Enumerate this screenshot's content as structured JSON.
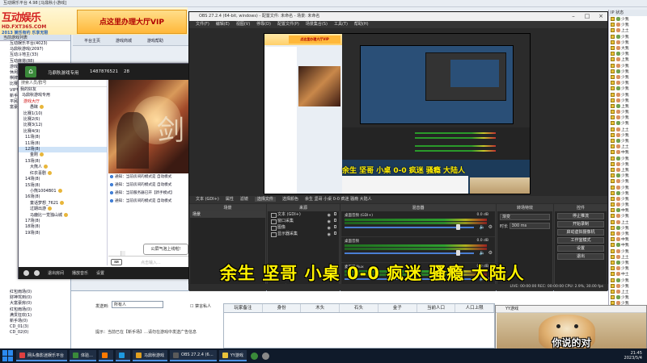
{
  "bg": {
    "window_title": "互动娱乐平台 4.98 [马鼎秋小游戏]",
    "logo_line1": "互动娱乐",
    "logo_line2": "HD.FXT365.COM",
    "logo_line3": "2013 娱乐有约 乐享无限",
    "vip_banner": "点这里办理大厅VIP",
    "toolbar": [
      "平台主页",
      "游戏商城",
      "游戏帮助"
    ],
    "left_header": "当前游戏列表",
    "left_tree": [
      "互动娱乐平台(4023)",
      "马鼎秋游戏(2097)",
      "互动斗地主(33)",
      "互动麻将(88)",
      "游戏大厅",
      "休闲游戏",
      "棋牌游戏",
      "比赛场",
      "VIP专区",
      "新手场",
      "平民场",
      "富豪场"
    ],
    "bottom_tree": [
      "红包雨场(0)",
      "财神驾到(0)",
      "大富豪房(0)",
      "红包雨场(0)",
      "满贯狂欢(1)",
      "新手场(0)",
      "CD_01(3)",
      "CD_02(0)"
    ],
    "send_label": "发送到:",
    "send_to": "所有人",
    "check_label": "禁言私人",
    "tip": "提示：当前已在【新手场】…请勿在游戏中发送广告信息",
    "table_headers": [
      "玩家备注",
      "身份",
      "木头",
      "石头",
      "金子",
      "当前人口",
      "人口上限"
    ],
    "right_header": "IP 状态",
    "right_names": [
      "少我",
      "少我",
      "上土",
      "少我",
      "少我",
      "大我",
      "少我",
      "上我",
      "少我",
      "少我",
      "少我",
      "少我",
      "少我",
      "少我",
      "少我",
      "上我",
      "少我",
      "少我",
      "少我",
      "上土",
      "少我",
      "少我",
      "上土",
      "中我",
      "少我",
      "少我",
      "上我",
      "少我",
      "少我",
      "少我",
      "少我",
      "少我",
      "少我",
      "中我",
      "少我",
      "上土",
      "少我",
      "少我",
      "中我",
      "中我",
      "少我",
      "上土",
      "少我",
      "少我",
      "中土",
      "少我",
      "少我",
      "上土",
      "少我",
      "少我",
      "少我",
      "少我",
      "中土",
      "少我",
      "少我",
      "少我"
    ]
  },
  "chat": {
    "title": "马鼎秋游戏专用",
    "id": "1487876521",
    "count": "28",
    "search": "搜索人员/群号",
    "tree": [
      {
        "t": "我的好友",
        "ind": 2,
        "cls": ""
      },
      {
        "t": "马鼎秋游戏专用",
        "ind": 4,
        "cls": ""
      },
      {
        "t": "游戏大厅",
        "ind": 6,
        "cls": "red"
      },
      {
        "t": "愚昧",
        "ind": 14,
        "cls": ""
      },
      {
        "t": "比赛1(10)",
        "ind": 6,
        "cls": ""
      },
      {
        "t": "比赛2(6)",
        "ind": 6,
        "cls": ""
      },
      {
        "t": "比赛3(12)",
        "ind": 6,
        "cls": ""
      },
      {
        "t": "比赛4(9)",
        "ind": 6,
        "cls": ""
      },
      {
        "t": "11场(8)",
        "ind": 8,
        "cls": ""
      },
      {
        "t": "11场(8)",
        "ind": 8,
        "cls": ""
      },
      {
        "t": "12场(8)",
        "ind": 8,
        "cls": "sel"
      },
      {
        "t": "金刚",
        "ind": 14,
        "cls": ""
      },
      {
        "t": "13场(8)",
        "ind": 8,
        "cls": ""
      },
      {
        "t": "大熊人",
        "ind": 14,
        "cls": ""
      },
      {
        "t": "红衣喜剧",
        "ind": 14,
        "cls": ""
      },
      {
        "t": "14场(8)",
        "ind": 8,
        "cls": ""
      },
      {
        "t": "15场(8)",
        "ind": 8,
        "cls": ""
      },
      {
        "t": "小熊1004B01",
        "ind": 14,
        "cls": ""
      },
      {
        "t": "16场(8)",
        "ind": 8,
        "cls": ""
      },
      {
        "t": "童话梦想_7621",
        "ind": 14,
        "cls": ""
      },
      {
        "t": "过期出游",
        "ind": 14,
        "cls": ""
      },
      {
        "t": "马鹿比一觉独山城",
        "ind": 14,
        "cls": ""
      },
      {
        "t": "17场(8)",
        "ind": 8,
        "cls": ""
      },
      {
        "t": "18场(8)",
        "ind": 8,
        "cls": ""
      },
      {
        "t": "19场(8)",
        "ind": 8,
        "cls": ""
      }
    ],
    "messages": [
      "通知：当前房间的模式是 自动模式",
      "通知：当前房间的模式是 自动模式",
      "通知：当前服务器已开【新手模式】",
      "通知：当前房间的模式是 自动模式"
    ],
    "bubble": "公屏气泡上线啦!",
    "input_placeholder": "点击输入...",
    "bar_items": [
      "退出房间",
      "播放音乐",
      "设置"
    ]
  },
  "obs": {
    "title": "OBS 27.2.4 (64-bit, windows) - 配置文件: 未命名 - 场景: 未命名",
    "menu": [
      "文件(F)",
      "编辑(E)",
      "视图(V)",
      "停靠(D)",
      "配置文件(P)",
      "场景集合(S)",
      "工具(T)",
      "帮助(H)"
    ],
    "tabs": [
      "文本 (GDI+)",
      "属性",
      "滤镜",
      "选择文件",
      "选择颜色",
      "余生 坚哥 小桌 0-0 疯迷 骚瘾 大陆人"
    ],
    "panels": {
      "scenes": "场景",
      "sources": "来源",
      "mixer": "混音器",
      "transitions": "转场特效",
      "controls": "控件"
    },
    "scene": "场景",
    "sources": [
      {
        "name": "文本 (GDI+)"
      },
      {
        "name": "窗口采集"
      },
      {
        "name": "图像"
      },
      {
        "name": "显示器采集"
      }
    ],
    "mixer": [
      {
        "name": "桌面音频 (GDI+)",
        "db": "0.0 dB",
        "level": 0.86
      },
      {
        "name": "桌面音频",
        "db": "0.0 dB",
        "level": 0.86
      },
      {
        "name": "麦克风/Aux",
        "db": "0.0 dB",
        "level": 0.86
      }
    ],
    "transition_type": "渐变",
    "transition_label": "时长",
    "transition_ms": "300 ms",
    "controls": [
      "停止推流",
      "开始录制",
      "启动虚拟摄像机",
      "工作室模式",
      "设置",
      "退出"
    ],
    "status": "LIVE: 00:00:00  REC: 00:00:00  CPU: 2.9%, 30.00 fps",
    "nested_subtitle": "余生 坚哥 小桌 0-0 疯迷 骚瘾 大陆人"
  },
  "subtitle": "余生 坚哥 小桌 0-0 疯迷 骚瘾 大陆人",
  "meme": {
    "title": "YY游戏",
    "caption": "你说的对"
  },
  "taskbar": {
    "tasks": [
      {
        "label": "网头像影迷娱乐平台",
        "color": "#e04040"
      },
      {
        "label": "体验…",
        "color": "#3a8a3a"
      },
      {
        "label": "",
        "color": "#ff7a00"
      },
      {
        "label": "",
        "color": "#1e9ae0"
      },
      {
        "label": "马鼎秋游戏",
        "color": "#e0a020"
      },
      {
        "label": "OBS 27.2.4 (6…",
        "color": "#5a5a5a"
      },
      {
        "label": "YY游戏",
        "color": "#e8c23a"
      }
    ],
    "time": "21:45\n2023/5/4"
  },
  "colors": {
    "accent": "#4a90e2",
    "subtitle": "#fff200",
    "vip": "#b00000"
  }
}
